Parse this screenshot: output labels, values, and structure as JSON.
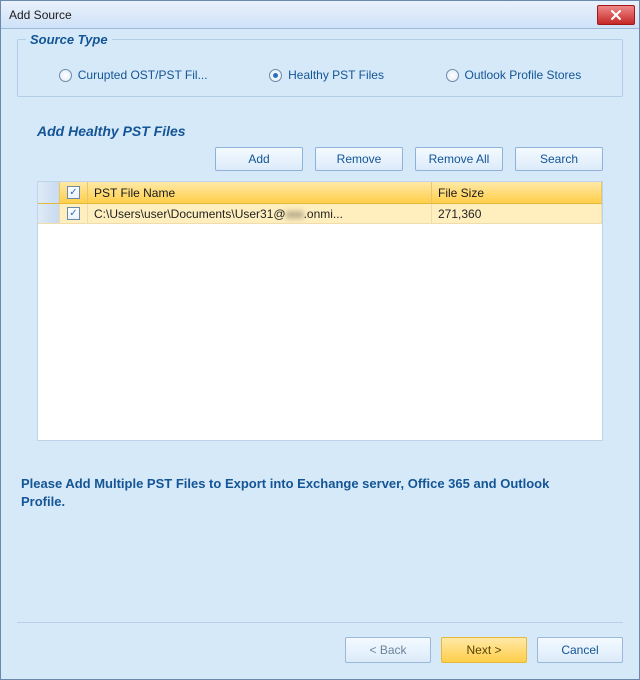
{
  "title": "Add Source",
  "source_type": {
    "label": "Source Type",
    "options": [
      {
        "label": "Curupted OST/PST Fil...",
        "checked": false
      },
      {
        "label": "Healthy PST Files",
        "checked": true
      },
      {
        "label": "Outlook Profile Stores",
        "checked": false
      }
    ]
  },
  "section_label": "Add Healthy PST Files",
  "toolbar": {
    "add": "Add",
    "remove": "Remove",
    "remove_all": "Remove All",
    "search": "Search"
  },
  "table": {
    "headers": {
      "name": "PST File Name",
      "size": "File Size"
    },
    "header_checked": true,
    "rows": [
      {
        "checked": true,
        "name_prefix": "C:\\Users\\user\\Documents\\User31@",
        "name_blurred": "xxx",
        "name_suffix": ".onmi...",
        "size": "271,360"
      }
    ]
  },
  "hint": "Please Add Multiple PST Files to Export into Exchange server, Office 365 and Outlook Profile.",
  "wizard": {
    "back": "< Back",
    "next": "Next >",
    "cancel": "Cancel"
  }
}
